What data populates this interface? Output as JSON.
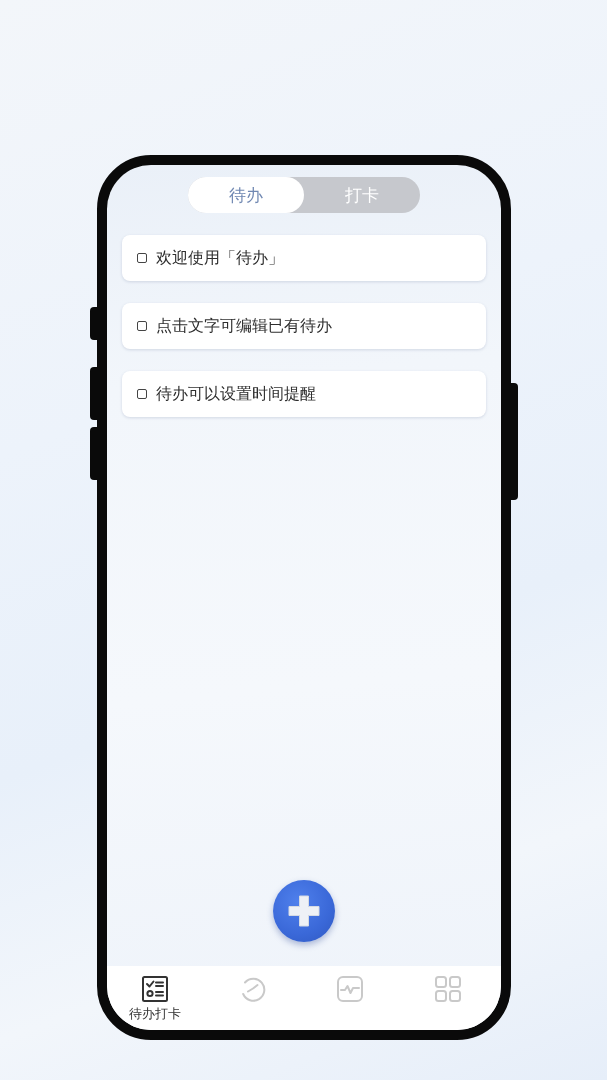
{
  "tabs": [
    {
      "label": "待办",
      "selected": true
    },
    {
      "label": "打卡",
      "selected": false
    }
  ],
  "todos": [
    {
      "text": "欢迎使用「待办」",
      "checked": false
    },
    {
      "text": "点击文字可编辑已有待办",
      "checked": false
    },
    {
      "text": "待办可以设置时间提醒",
      "checked": false
    }
  ],
  "nav": [
    {
      "kind": "checklist",
      "label": "待办打卡",
      "selected": true
    },
    {
      "kind": "clock",
      "selected": false
    },
    {
      "kind": "pulse",
      "selected": false
    },
    {
      "kind": "grid",
      "selected": false
    }
  ]
}
